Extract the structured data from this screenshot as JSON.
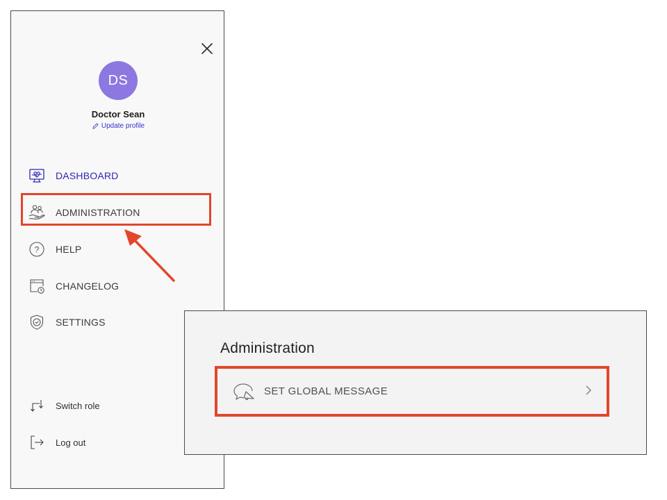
{
  "drawer": {
    "avatar_initials": "DS",
    "user_name": "Doctor Sean",
    "update_profile_label": "Update profile",
    "nav_items": [
      {
        "label": "DASHBOARD",
        "icon": "dashboard-monitor-heart-icon",
        "active": true
      },
      {
        "label": "ADMINISTRATION",
        "icon": "users-hand-icon",
        "active": false
      },
      {
        "label": "HELP",
        "icon": "question-circle-icon",
        "active": false
      },
      {
        "label": "CHANGELOG",
        "icon": "browser-clock-icon",
        "active": false
      },
      {
        "label": "SETTINGS",
        "icon": "shield-check-icon",
        "active": false
      }
    ],
    "footer_items": [
      {
        "label": "Switch role",
        "icon": "switch-arrows-icon"
      },
      {
        "label": "Log out",
        "icon": "logout-icon"
      }
    ]
  },
  "admin_panel": {
    "title": "Administration",
    "items": [
      {
        "label": "SET GLOBAL MESSAGE",
        "icon": "chat-megaphone-icon"
      }
    ]
  },
  "colors": {
    "accent": "#2d26b4",
    "avatar": "#8c78e0",
    "highlight": "#e2462b"
  }
}
